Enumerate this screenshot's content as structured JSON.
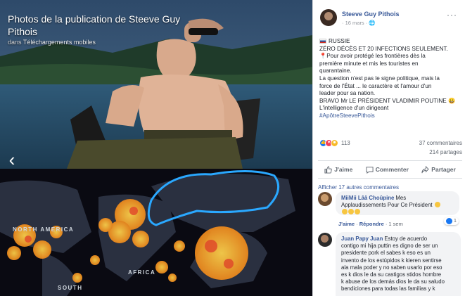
{
  "viewer": {
    "title": "Photos de la publication de Steeve Guy Pithois",
    "subtitle_prefix": "dans",
    "subtitle_album": "Téléchargements mobiles",
    "prev_arrow": "‹",
    "map_labels": {
      "north_america": "NORTH AMERICA",
      "africa": "AFRICA",
      "south": "SOUTH"
    }
  },
  "post": {
    "author": "Steeve Guy Pithois",
    "date": "16 mars",
    "lines": [
      "RUSSIE",
      "ZÉRO DÉCÈS ET 20 INFECTIONS SEULEMENT.",
      "📍Pour avoir protégé les frontières dès la",
      "première minute et mis les touristes en",
      "quarantaine.",
      "La question n'est pas le signe politique, mais la",
      "force de l'État ... le caractère et l'amour d'un",
      "leader pour sa nation.",
      "BRAVO Mr LE PRÉSIDENT VLADIMIR POUTINE 😀",
      "L'intelligence d'un dirigeant"
    ],
    "hashtag": "#ApôtreSteevePithois",
    "reactions_count": "113",
    "comments_count": "37 commentaires",
    "shares_count": "214 partages",
    "actions": {
      "like": "J'aime",
      "comment": "Commenter",
      "share": "Partager"
    }
  },
  "comments": {
    "more_label": "Afficher 17 autres commentaires",
    "items": [
      {
        "author": "MiiMii Lââ Choûpine",
        "lines": [
          "Mes",
          "Applaudissements Pour Ce Président"
        ],
        "like_label": "J'aime",
        "reply_label": "Répondre",
        "time": "1 sem",
        "likes": "1"
      },
      {
        "author": "Juan Papy Juan",
        "lines": [
          "Estoy de acuerdo",
          "contigo mi hija puttin es digno de ser un",
          "presidente pork el sabes k eso es un",
          "invento de los estúpidos k kieren sentirse",
          "ala mala poder y no saben usarlo por eso",
          "es k dios le da su castigos stidos hombre",
          "k abuse de los demás dios le da su saludo",
          "bendiciones para todas las familias y k"
        ]
      }
    ]
  },
  "colors": {
    "link": "#385898",
    "secondary": "#606770",
    "like_blue": "#1877f2",
    "covid_orange": "#f5a623",
    "highlight_blue": "#2aa8ff"
  }
}
